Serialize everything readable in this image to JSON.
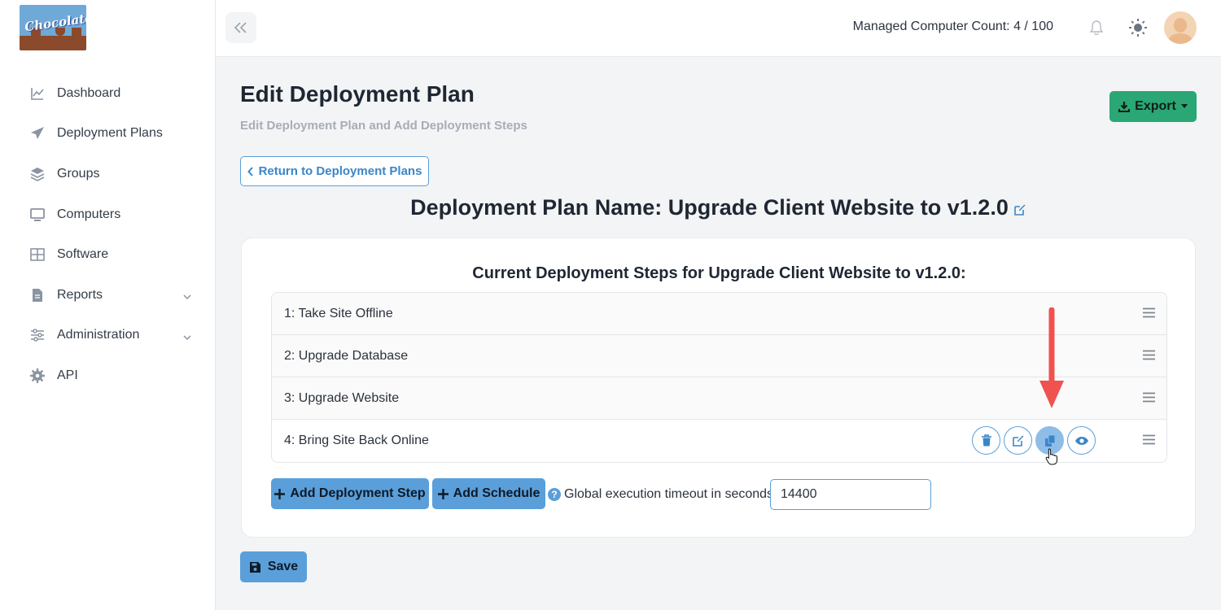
{
  "brand": {
    "logo_text": "Chocolatey"
  },
  "sidebar": {
    "items": [
      {
        "label": "Dashboard",
        "icon": "chart-line-icon"
      },
      {
        "label": "Deployment Plans",
        "icon": "paper-plane-icon"
      },
      {
        "label": "Groups",
        "icon": "layers-icon"
      },
      {
        "label": "Computers",
        "icon": "monitor-icon"
      },
      {
        "label": "Software",
        "icon": "grid-icon"
      },
      {
        "label": "Reports",
        "icon": "file-icon",
        "expandable": true
      },
      {
        "label": "Administration",
        "icon": "sliders-icon",
        "expandable": true
      },
      {
        "label": "API",
        "icon": "gear-icon"
      }
    ]
  },
  "topbar": {
    "managed_count": "Managed Computer Count: 4 / 100"
  },
  "header": {
    "title": "Edit Deployment Plan",
    "subtitle": "Edit Deployment Plan and Add Deployment Steps",
    "export_label": "Export",
    "return_label": "Return to Deployment Plans"
  },
  "plan": {
    "name": "Deployment Plan Name: Upgrade Client Website to v1.2.0"
  },
  "steps": {
    "title": "Current Deployment Steps for Upgrade Client Website to v1.2.0:",
    "items": [
      {
        "label": "1: Take Site Offline"
      },
      {
        "label": "2: Upgrade Database"
      },
      {
        "label": "3: Upgrade Website"
      },
      {
        "label": "4: Bring Site Back Online"
      }
    ]
  },
  "actions": {
    "add_step_label": "Add Deployment Step",
    "add_schedule_label": "Add Schedule",
    "timeout_label": "Global execution timeout in seconds",
    "timeout_value": "14400",
    "save_label": "Save"
  },
  "colors": {
    "primary": "#5a9fd9",
    "success": "#2aa774",
    "annotation_arrow": "#f0524f"
  }
}
